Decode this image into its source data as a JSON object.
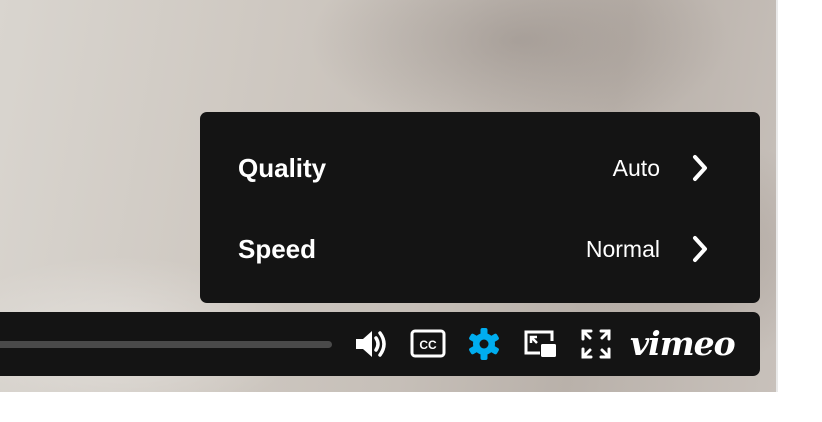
{
  "settings_menu": {
    "items": [
      {
        "label": "Quality",
        "value": "Auto",
        "icon": "chevron-right-icon"
      },
      {
        "label": "Speed",
        "value": "Normal",
        "icon": "chevron-right-icon"
      }
    ]
  },
  "controls": {
    "icons": [
      "volume-icon",
      "closed-captions-icon",
      "settings-gear-icon",
      "picture-in-picture-icon",
      "fullscreen-icon"
    ],
    "cc_text": "CC",
    "brand": "vimeo",
    "settings_active_color": "#00adef",
    "icon_color": "#ffffff"
  }
}
